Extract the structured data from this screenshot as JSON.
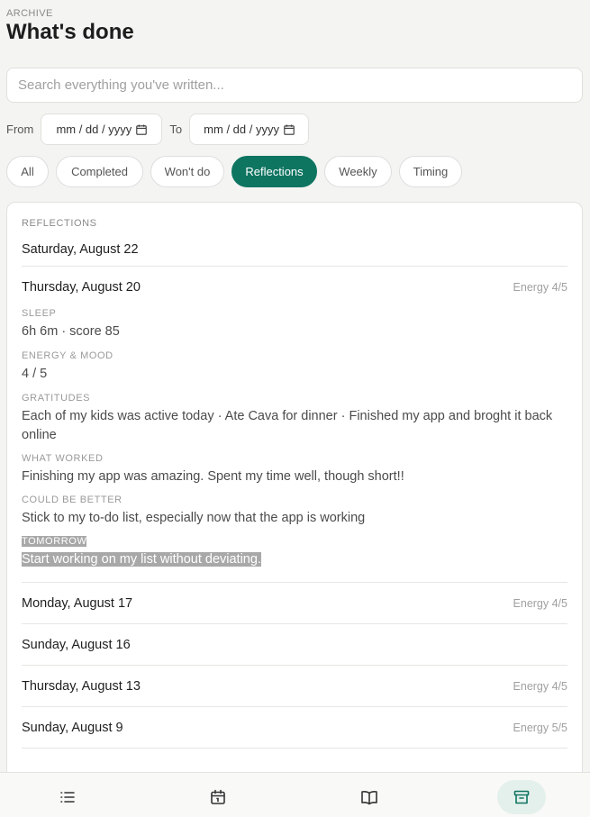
{
  "header": {
    "eyebrow": "ARCHIVE",
    "title": "What's done"
  },
  "search": {
    "placeholder": "Search everything you've written..."
  },
  "dates": {
    "from_label": "From",
    "from_value": "mm / dd / yyyy",
    "to_label": "To",
    "to_value": "mm / dd / yyyy"
  },
  "filters": [
    {
      "label": "All"
    },
    {
      "label": "Completed"
    },
    {
      "label": "Won't do"
    },
    {
      "label": "Reflections",
      "active": true
    },
    {
      "label": "Weekly"
    },
    {
      "label": "Timing"
    }
  ],
  "reflections": {
    "heading": "REFLECTIONS",
    "entries": [
      {
        "date": "Saturday, August 22",
        "energy": ""
      },
      {
        "date": "Thursday, August 20",
        "energy": "Energy 4/5"
      },
      {
        "date": "Monday, August 17",
        "energy": "Energy 4/5"
      },
      {
        "date": "Sunday, August 16",
        "energy": ""
      },
      {
        "date": "Thursday, August 13",
        "energy": "Energy 4/5"
      },
      {
        "date": "Sunday, August 9",
        "energy": "Energy 5/5"
      }
    ],
    "detail": {
      "sleep_label": "SLEEP",
      "sleep_text": "6h 6m · score 85",
      "energy_label": "ENERGY & MOOD",
      "energy_text": "4 / 5",
      "gratitudes_label": "GRATITUDES",
      "gratitudes_text": "Each of my kids was active today · Ate Cava for dinner · Finished my app and broght it back online",
      "worked_label": "WHAT WORKED",
      "worked_text": "Finishing my app was amazing. Spent my time well, though short!!",
      "better_label": "COULD BE BETTER",
      "better_text": "Stick to my to-do list, especially now that the app is working",
      "tomorrow_label": "TOMORROW",
      "tomorrow_text": "Start working on my list without deviating."
    }
  },
  "nav": {
    "items": [
      {
        "icon": "list-icon"
      },
      {
        "icon": "calendar-icon"
      },
      {
        "icon": "book-icon"
      },
      {
        "icon": "archive-icon",
        "active": true
      }
    ]
  },
  "colors": {
    "accent": "#0e7561",
    "nav_active_bg": "#e4f0ec"
  }
}
